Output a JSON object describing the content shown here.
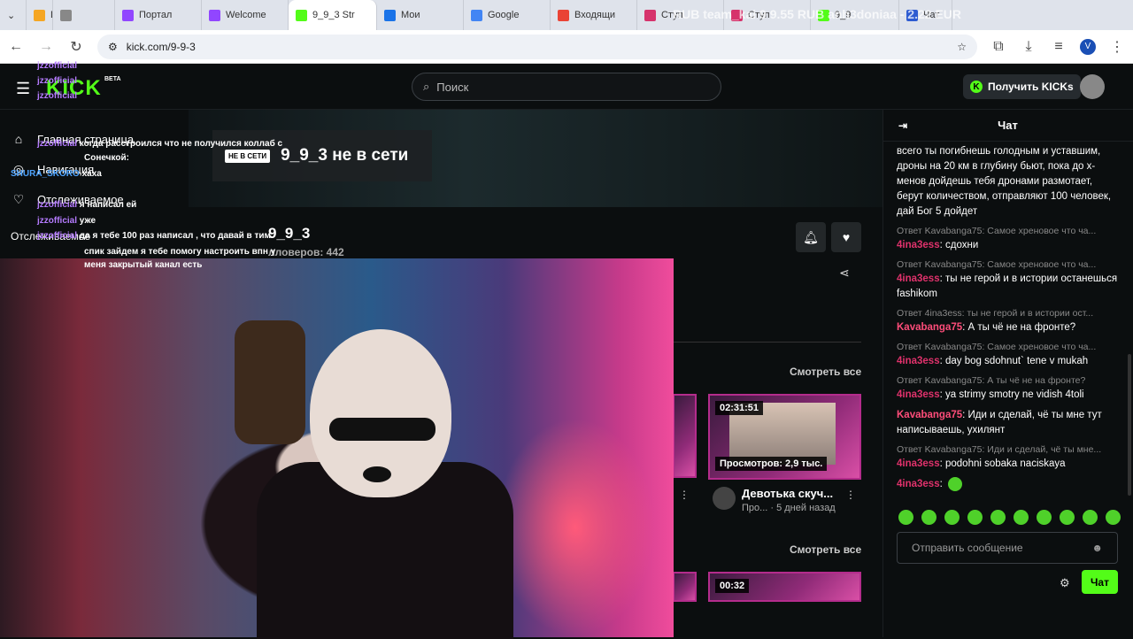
{
  "browser": {
    "tabs": [
      {
        "label": "D",
        "color": "#f5a623"
      },
      {
        "label": "",
        "color": "#888888"
      },
      {
        "label": "Портал",
        "color": "#9146ff"
      },
      {
        "label": "Welcome",
        "color": "#9146ff"
      },
      {
        "label": "9_9_3 Str",
        "color": "#53fc18"
      },
      {
        "label": "Мои",
        "color": "#1a73e8"
      },
      {
        "label": "Google",
        "color": "#4285f4"
      },
      {
        "label": "Входящи",
        "color": "#ea4335"
      },
      {
        "label": "Ступ",
        "color": "#d6336c"
      },
      {
        "label": "Ступ",
        "color": "#d6336c"
      },
      {
        "label": "9_9",
        "color": "#53fc18"
      },
      {
        "label": "Чат",
        "color": "#2d5bd1"
      }
    ],
    "watermark": "RUB   team_kai 9 9.55 RUB   anh3doniaa - 2.22 EUR",
    "url": "kick.com/9-9-3",
    "profile_letter": "V"
  },
  "header": {
    "logo": "KICK",
    "beta": "BETA",
    "search_placeholder": "Поиск",
    "kicks_button": "Получить KICKs"
  },
  "sidenav": {
    "items": [
      "Главная страница",
      "Навигация",
      "Отслеживаемое"
    ],
    "section": "Отслеживаемое"
  },
  "channel": {
    "offline_badge": "НЕ В СЕТИ",
    "offline_text": "9_9_3 не в сети",
    "name": "9_9_3",
    "followers": "лловеров: 442"
  },
  "videos": {
    "see_all": "Смотреть все",
    "items": [
      {
        "duration": "02:31:51",
        "views": "Просмотров: 2,9 тыс.",
        "title": "Девотька скуч...",
        "meta_a": "Про...",
        "meta_b": "5 дней назад"
      },
      {
        "duration": "00:32"
      }
    ]
  },
  "overlay_chat": [
    {
      "user": "jzzofficial",
      "text": ""
    },
    {
      "user": "jzzofficial",
      "text": ""
    },
    {
      "user": "jzzofficial",
      "text": ""
    },
    {
      "user": "jzzofficial",
      "text": "когда расстроился что не получился коллаб с"
    },
    {
      "user": "",
      "text": "Сонечкой:"
    },
    {
      "user": "SHURA_SKORO",
      "text": "хаха"
    },
    {
      "user": "jzzofficial",
      "text": "я написал ей"
    },
    {
      "user": "jzzofficial",
      "text": "уже"
    },
    {
      "user": "jzzofficial",
      "text": "да я тебе 100 раз написал , что давай в тим"
    },
    {
      "user": "",
      "text": "спик зайдем я тебе помогу настроить впн у"
    },
    {
      "user": "",
      "text": "меня закрытый канал есть"
    }
  ],
  "chat": {
    "title": "Чат",
    "messages": [
      {
        "reply": "",
        "user": "",
        "text": "всего ты погибнешь голодным и уставшим, дроны на 20 км в глубину бьют, пока до х-менов дойдешь тебя дронами размотает, берут количеством, отправляют 100 человек, дай Бог 5 дойдет"
      },
      {
        "reply": "Ответ Kavabanga75: Самое хреновое что ча...",
        "user": "4ina3ess",
        "text": ": сдохни"
      },
      {
        "reply": "Ответ Kavabanga75: Самое хреновое что ча...",
        "user": "4ina3ess",
        "text": ": ты не герой и в истории останешься fashikom"
      },
      {
        "reply": "Ответ 4ina3ess: ты не герой и в истории ост...",
        "user": "Kavabanga75",
        "text": ": А ты чё не на фронте?"
      },
      {
        "reply": "Ответ Kavabanga75: Самое хреновое что ча...",
        "user": "4ina3ess",
        "text": ": day bog sdohnut` tene v mukah"
      },
      {
        "reply": "Ответ Kavabanga75: А ты чё не на фронте?",
        "user": "4ina3ess",
        "text": ": ya strimy smotry ne vidish 4toli"
      },
      {
        "reply": "",
        "user": "Kavabanga75",
        "text": ": Иди и сделай, чё ты мне тут написываешь, ухилянт"
      },
      {
        "reply": "Ответ Kavabanga75: Иди и сделай, чё ты мне...",
        "user": "4ina3ess",
        "text": ": podohni sobaka naciskaya"
      },
      {
        "reply": "",
        "user": "4ina3ess",
        "text": ":"
      }
    ],
    "input_placeholder": "Отправить сообщение",
    "send_label": "Чат"
  }
}
